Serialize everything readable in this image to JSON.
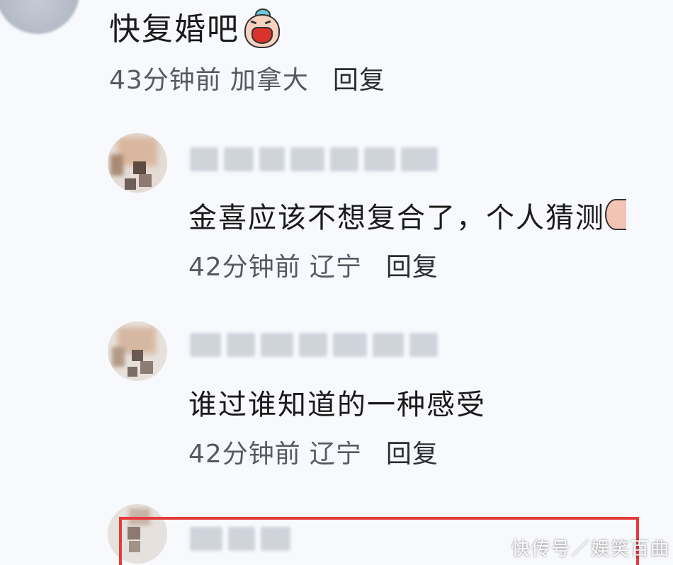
{
  "main_comment": {
    "text": "快复婚吧",
    "emoji": "laughing-face-emoji",
    "time": "43分钟前",
    "location": "加拿大",
    "reply_label": "回复"
  },
  "replies": [
    {
      "text": "金喜应该不想复合了，个人猜测",
      "time": "42分钟前",
      "location": "辽宁",
      "reply_label": "回复"
    },
    {
      "text": "谁过谁知道的一种感受",
      "time": "42分钟前",
      "location": "辽宁",
      "reply_label": "回复"
    }
  ],
  "highlight_color": "#e53b3b",
  "watermark": "快传号／娱笑百曲"
}
